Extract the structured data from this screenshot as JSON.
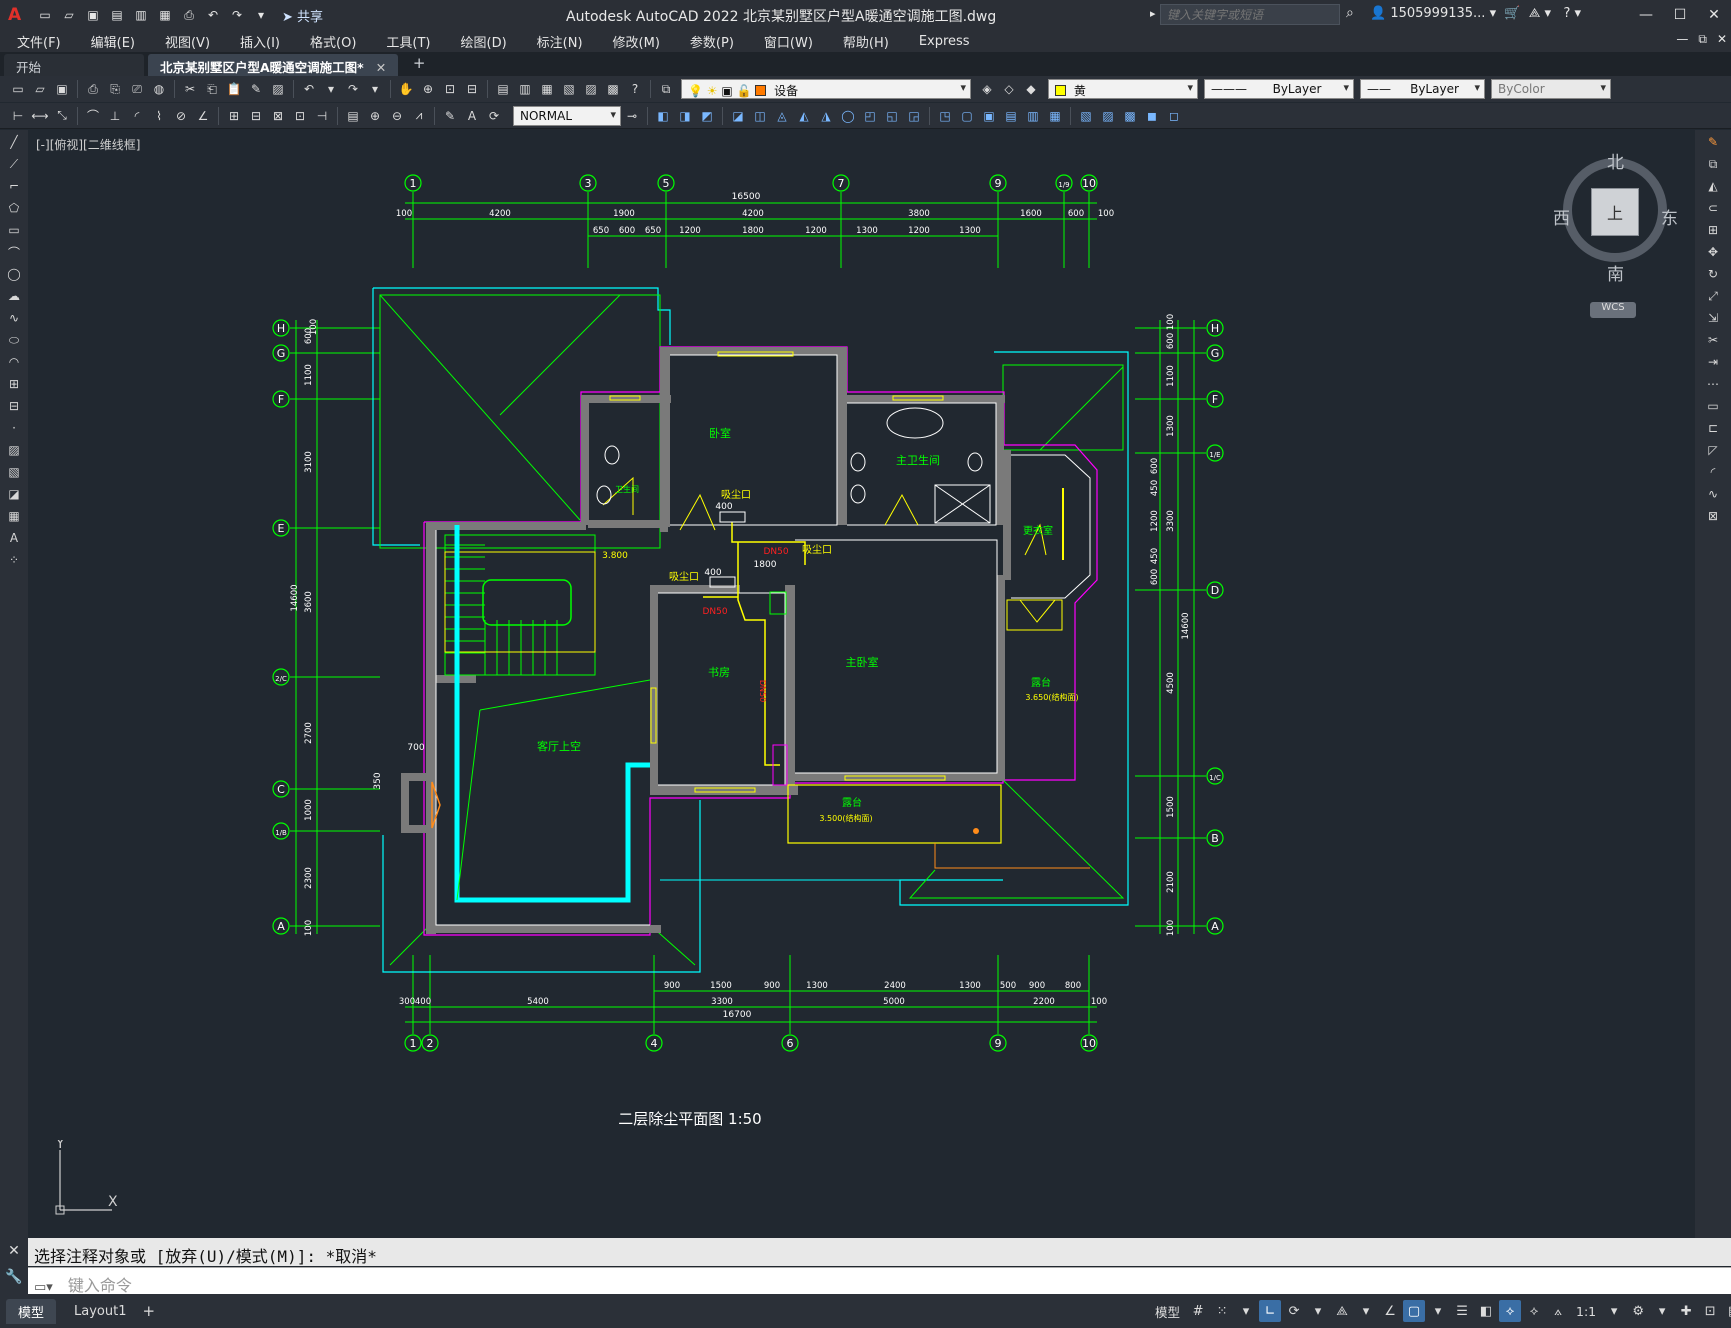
{
  "title_bar": {
    "logo": "A",
    "share_label": "共享",
    "title": "Autodesk AutoCAD 2022    北京某别墅区户型A暖通空调施工图.dwg",
    "search_placeholder": "键入关键字或短语",
    "user": "1505999135...",
    "help": "?"
  },
  "menu": [
    "文件(F)",
    "编辑(E)",
    "视图(V)",
    "插入(I)",
    "格式(O)",
    "工具(T)",
    "绘图(D)",
    "标注(N)",
    "修改(M)",
    "参数(P)",
    "窗口(W)",
    "帮助(H)",
    "Express"
  ],
  "tabs": {
    "start": "开始",
    "active": "北京某别墅区户型A暖通空调施工图*",
    "close": "✕",
    "add": "+"
  },
  "toolbar": {
    "layer_name": "设备",
    "color_name": "黄",
    "linetype": "ByLayer",
    "lineweight": "ByLayer",
    "plotstyle": "ByColor",
    "text_style": "NORMAL"
  },
  "viewport": {
    "label": "[-][俯视][二维线框]",
    "viewcube": {
      "north": "北",
      "south": "南",
      "east": "东",
      "west": "西",
      "face": "上",
      "wcs": "WCS"
    },
    "ucs": {
      "x": "X",
      "y": "Y"
    }
  },
  "drawing": {
    "top_axes": [
      "1",
      "3",
      "5",
      "7",
      "9",
      "1/9",
      "10"
    ],
    "bottom_axes": [
      "1",
      "2",
      "4",
      "6",
      "9",
      "10"
    ],
    "left_axes": [
      "H",
      "G",
      "F",
      "E",
      "2/C",
      "C",
      "1/B",
      "A"
    ],
    "right_axes": [
      "H",
      "G",
      "F",
      "1/E",
      "D",
      "1/C",
      "B",
      "A"
    ],
    "top_total": "16500",
    "top_dims_row1": [
      "100",
      "4200",
      "1900",
      "4200",
      "3800",
      "1600",
      "600",
      "100"
    ],
    "top_dims_row2": [
      "650",
      "600",
      "650",
      "1200",
      "1800",
      "1200",
      "1300",
      "1200",
      "1300"
    ],
    "bottom_dims_row1": [
      "900",
      "1500",
      "900",
      "1300",
      "2400",
      "1300",
      "500",
      "900",
      "800"
    ],
    "bottom_dims_row2": [
      "300",
      "400",
      "5400",
      "3300",
      "5000",
      "2200",
      "100"
    ],
    "bottom_total": "16700",
    "left_dims": [
      "600",
      "100",
      "1100",
      "3100",
      "3600",
      "14600",
      "2700",
      "1000",
      "2300",
      "100"
    ],
    "right_dims": [
      "100",
      "600",
      "1100",
      "1300",
      "600",
      "450",
      "1200",
      "450",
      "600",
      "3300",
      "4500",
      "14600",
      "1500",
      "2100",
      "100"
    ],
    "rooms": {
      "bedroom": "卧室",
      "bathroom": "卫生间",
      "master_bath": "主卫生间",
      "closet": "更衣室",
      "study": "书房",
      "master_bed": "主卧室",
      "living_void": "客厅上空",
      "terrace_right": "露台",
      "terrace_bottom": "露台"
    },
    "labels": {
      "vent1": "吸尘口",
      "vent2": "吸尘口",
      "vent3": "吸尘口",
      "d400a": "400",
      "d400b": "400",
      "d1800": "1800",
      "dn50a": "DN50",
      "dn50b": "DN50",
      "dn50c": "DN50",
      "elev_3800": "3.800",
      "elev_3650": "3.650(结构面)",
      "elev_3500": "3.500(结构面)",
      "d700": "700",
      "d350": "350"
    },
    "plan_title": "二层除尘平面图 1:50"
  },
  "command": {
    "history": "选择注释对象或 [放弃(U)/模式(M)]: *取消*",
    "placeholder": "键入命令"
  },
  "status": {
    "tabs": [
      "模型",
      "Layout1"
    ],
    "add": "+",
    "model_label": "模型",
    "scale": "1:1"
  }
}
